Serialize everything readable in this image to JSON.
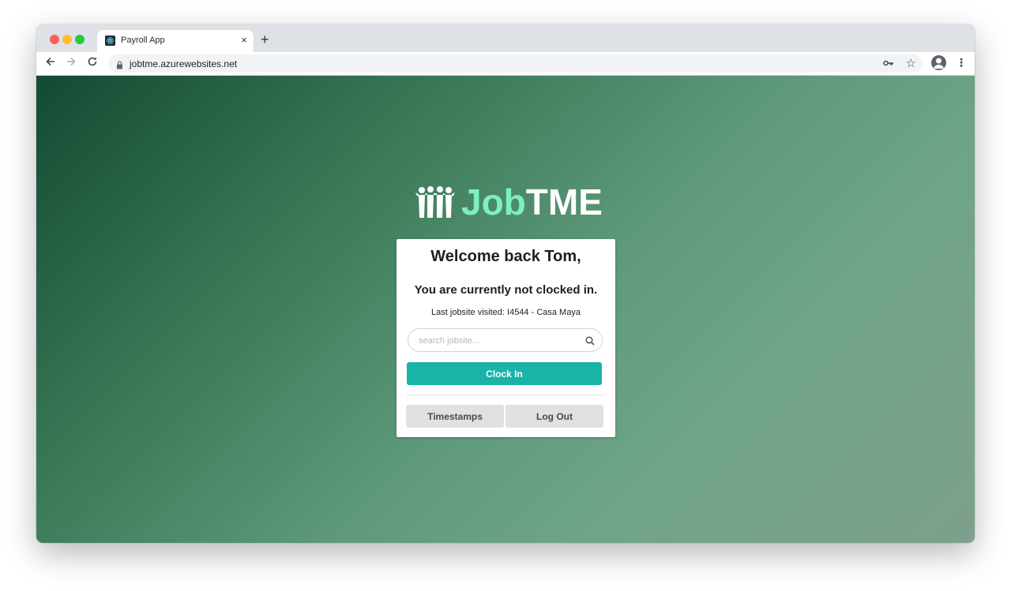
{
  "browser": {
    "tab_title": "Payroll App",
    "tab_close": "×",
    "new_tab": "+",
    "url": "jobtme.azurewebsites.net"
  },
  "logo": {
    "part1": "Job",
    "part2": "TME"
  },
  "card": {
    "welcome": "Welcome back Tom,",
    "status": "You are currently not clocked in.",
    "last_jobsite": "Last jobsite visited: I4544 - Casa Maya",
    "search_placeholder": "search jobsite...",
    "clock_in_label": "Clock In",
    "timestamps_label": "Timestamps",
    "logout_label": "Log Out"
  },
  "colors": {
    "accent": "#1ab3a8",
    "logo_green": "#7df0c2"
  }
}
